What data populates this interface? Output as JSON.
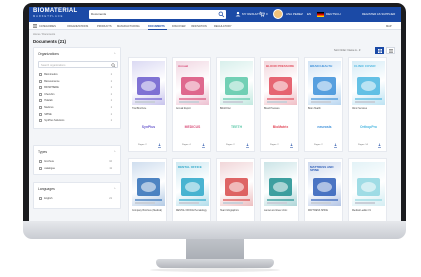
{
  "header": {
    "logo": "BIOMATERIAL",
    "logo_sub": "MARKETPLACE",
    "search_category": "Documents",
    "search_placeholder": "",
    "my_results": "MY RESULTS",
    "cart_count": "0",
    "user": "ANA PEREZ",
    "lang": "EN",
    "country": "DEUTSCH",
    "register": "REGISTER AS SUPPLIER"
  },
  "nav": {
    "items": [
      "CATEGORIES",
      "ORGANIZATIONS",
      "PRODUCTS",
      "MANUFACTURING",
      "DOCUMENTS",
      "DISCOVER",
      "INNOVATION",
      "REGULATORY",
      "MAP"
    ],
    "active_index": 4
  },
  "breadcrumb": "Home / Documents",
  "page_title": "Documents (21)",
  "sort": "Sort Order: Name A - Z",
  "sidebar": {
    "orgs_title": "Organizations",
    "search_placeholder": "Search organizations",
    "orgs": [
      {
        "label": "Biomimetics",
        "count": "1"
      },
      {
        "label": "Bioresonance",
        "count": "1"
      },
      {
        "label": "BIOSPHERE",
        "count": "1"
      },
      {
        "label": "Cherubin",
        "count": "1"
      },
      {
        "label": "Hdwtab",
        "count": "1"
      },
      {
        "label": "Medicus",
        "count": "1"
      },
      {
        "label": "SPINE",
        "count": "1"
      },
      {
        "label": "SynPlus Solutions",
        "count": "1"
      }
    ],
    "types_title": "Types",
    "types": [
      {
        "label": "brochure",
        "count": "10"
      },
      {
        "label": "catalogue",
        "count": "11"
      }
    ],
    "languages_title": "Languages",
    "languages": [
      {
        "label": "English",
        "count": "21"
      }
    ]
  },
  "cards_row1": [
    {
      "title": "Trial Brochure",
      "logo": "SynPlus",
      "pages": "Pages: 2"
    },
    {
      "title": "Annual Report",
      "logo": "MEDICUS",
      "pages": "Pages: 4"
    },
    {
      "title": "Bifold Flier",
      "logo": "TEETH",
      "pages": "Pages: 2"
    },
    {
      "title": "Blood Pressure",
      "logo": "BioMatrix",
      "pages": "Pages: 2"
    },
    {
      "title": "Brain Health",
      "logo": "neurosis",
      "pages": "Pages: 2"
    },
    {
      "title": "Clinic Services",
      "logo": "OrthopPro",
      "pages": "Pages: 14"
    }
  ],
  "thumbs_row1": [
    {
      "heading": "",
      "color": "#6a5acd"
    },
    {
      "heading": "Annual",
      "color": "#d94f7a"
    },
    {
      "heading": "",
      "color": "#5ac8a8"
    },
    {
      "heading": "BLOOD PRESSURE",
      "color": "#e24b5b"
    },
    {
      "heading": "BRAIN HEALTH",
      "color": "#3b8fd9"
    },
    {
      "heading": "CLINIC COVER",
      "color": "#49b6e0"
    }
  ],
  "cards_row2": [
    {
      "title": "Company Brochure (Medical)"
    },
    {
      "title": "DENTAL OFFICE Hematology"
    },
    {
      "title": "Heart Infographics"
    },
    {
      "title": "Lancet and lower clinic"
    },
    {
      "title": "MATTRESS SPINE"
    },
    {
      "title": "Medical Leaflet V1"
    }
  ],
  "thumbs_row2": [
    {
      "heading": "",
      "color": "#2f6fb7"
    },
    {
      "heading": "DENTAL OFFICE",
      "color": "#2aa7c9"
    },
    {
      "heading": "",
      "color": "#d84a4a"
    },
    {
      "heading": "",
      "color": "#1d8f8f"
    },
    {
      "heading": "MATTRESS AND SPINE",
      "color": "#2d5db8"
    },
    {
      "heading": "",
      "color": "#8fd6e0"
    }
  ],
  "colors": {
    "brand": "#1b4aa6",
    "bezel": "#1b1c1f"
  }
}
